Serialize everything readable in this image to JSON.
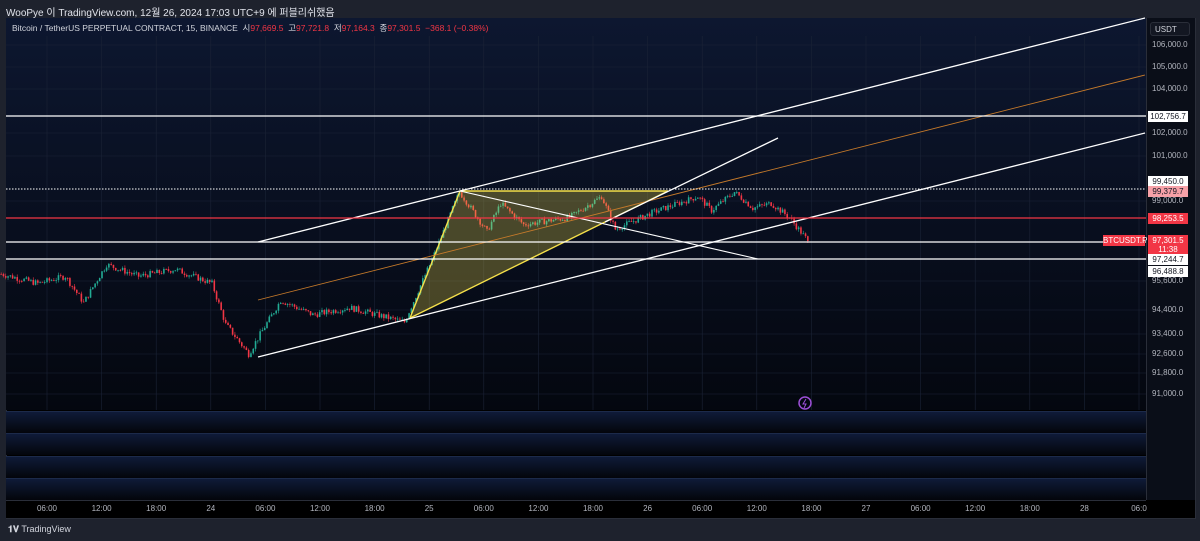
{
  "publish_line": "WooPye 이 TradingView.com, 12월 26, 2024 17:03 UTC+9 에 퍼블리쉬했음",
  "legend": {
    "symbol": "Bitcoin / TetherUS PERPETUAL CONTRACT, 15, BINANCE",
    "open_label": "시",
    "open": "97,669.5",
    "high_label": "고",
    "high": "97,721.8",
    "low_label": "저",
    "low": "97,164.3",
    "close_label": "종",
    "close": "97,301.5",
    "change": "−368.1 (−0.38%)"
  },
  "currency_button": "USDT",
  "price_ticks": [
    "106,000.0",
    "105,000.0",
    "104,000.0",
    "102,000.0",
    "101,000.0",
    "99,000.0",
    "95,600.0",
    "94,400.0",
    "93,400.0",
    "92,600.0",
    "91,800.0",
    "91,000.0"
  ],
  "price_labels": [
    {
      "value": "102,756.7",
      "style": "white"
    },
    {
      "value": "99,450.0",
      "style": "white"
    },
    {
      "value": "99,379.7",
      "style": "pink"
    },
    {
      "value": "98,253.5",
      "style": "red"
    },
    {
      "value": "97,301.5",
      "style": "red"
    },
    {
      "value": "11:38",
      "style": "red"
    },
    {
      "value": "97,244.7",
      "style": "white"
    },
    {
      "value": "96,488.8",
      "style": "white"
    }
  ],
  "symbol_tag": "BTCUSDT.P",
  "time_labels": [
    "06:00",
    "12:00",
    "18:00",
    "24",
    "06:00",
    "12:00",
    "18:00",
    "25",
    "06:00",
    "12:00",
    "18:00",
    "26",
    "06:00",
    "12:00",
    "18:00",
    "27",
    "06:00",
    "12:00",
    "18:00",
    "28",
    "06:0"
  ],
  "brand": "TradingView",
  "colors": {
    "up": "#22ab94",
    "down": "#f23645",
    "drawing_white": "#ffffff",
    "trend_orange": "#c67a2a",
    "triangle": "#f5e04a",
    "bg": "#0d1730"
  },
  "chart_data": {
    "type": "candlestick",
    "interval": "15",
    "price_scale": [
      91000,
      106500
    ],
    "approx_close_path": [
      [
        "12-23 01:00",
        95900
      ],
      [
        "12-23 05:00",
        95500
      ],
      [
        "12-23 08:00",
        95800
      ],
      [
        "12-23 10:00",
        94700
      ],
      [
        "12-23 12:30",
        96300
      ],
      [
        "12-23 16:00",
        95800
      ],
      [
        "12-23 20:00",
        96100
      ],
      [
        "12-24 00:00",
        95500
      ],
      [
        "12-24 01:30",
        93800
      ],
      [
        "12-24 04:00",
        92600
      ],
      [
        "12-24 07:30",
        94800
      ],
      [
        "12-24 11:00",
        94200
      ],
      [
        "12-24 15:00",
        94500
      ],
      [
        "12-24 21:00",
        93900
      ],
      [
        "12-25 00:00",
        96500
      ],
      [
        "12-25 03:00",
        99400
      ],
      [
        "12-25 06:00",
        97700
      ],
      [
        "12-25 07:30",
        98900
      ],
      [
        "12-25 10:00",
        98000
      ],
      [
        "12-25 15:00",
        98300
      ],
      [
        "12-25 18:30",
        99200
      ],
      [
        "12-25 20:00",
        97800
      ],
      [
        "12-26 00:00",
        98500
      ],
      [
        "12-26 05:00",
        99200
      ],
      [
        "12-26 06:30",
        98600
      ],
      [
        "12-26 09:00",
        99400
      ],
      [
        "12-26 11:00",
        98700
      ],
      [
        "12-26 13:00",
        98900
      ],
      [
        "12-26 15:00",
        98300
      ],
      [
        "12-26 17:00",
        97301.5
      ]
    ]
  }
}
